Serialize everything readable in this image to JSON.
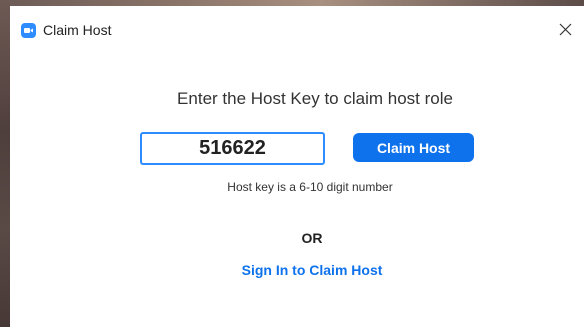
{
  "window": {
    "title": "Claim Host",
    "app_icon": "zoom-camera-icon",
    "close_icon": "close-icon"
  },
  "main": {
    "prompt": "Enter the Host Key to claim host role",
    "host_key_input": {
      "value": "516622",
      "placeholder": ""
    },
    "claim_button_label": "Claim Host",
    "hint": "Host key is a 6-10 digit number",
    "divider_label": "OR",
    "sign_in_link": "Sign In to Claim Host"
  },
  "colors": {
    "accent": "#0e72ed",
    "input_border": "#2d8cff",
    "app_icon": "#2d8cff"
  }
}
